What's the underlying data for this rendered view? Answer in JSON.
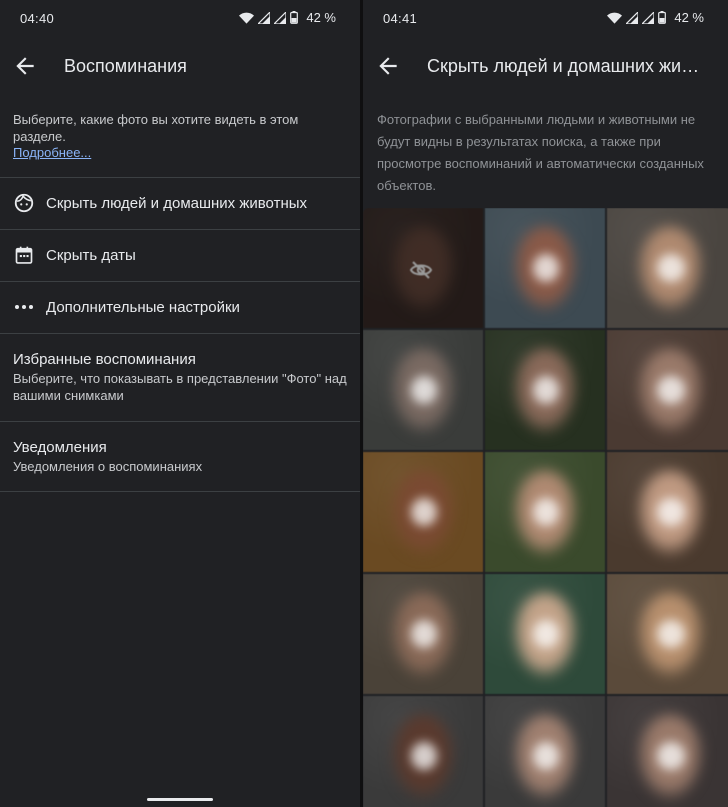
{
  "left": {
    "status": {
      "time": "04:40",
      "battery": "42 %"
    },
    "title": "Воспоминания",
    "intro": {
      "text": "Выберите, какие фото вы хотите видеть в этом разделе.",
      "link": "Подробнее..."
    },
    "menu": [
      {
        "label": "Скрыть людей и домашних животных",
        "icon": "face-icon"
      },
      {
        "label": "Скрыть даты",
        "icon": "calendar-icon"
      },
      {
        "label": "Дополнительные настройки",
        "icon": "more-icon"
      }
    ],
    "settings": [
      {
        "title": "Избранные воспоминания",
        "subtitle": "Выберите, что показывать в представлении \"Фото\" над вашими снимками"
      },
      {
        "title": "Уведомления",
        "subtitle": "Уведомления о воспоминаниях"
      }
    ]
  },
  "right": {
    "status": {
      "time": "04:41",
      "battery": "42 %"
    },
    "title": "Скрыть людей и домашних животных",
    "intro": "Фотографии с выбранными людьми и животными не будут видны в результатах поиска, а также при просмотре воспоминаний и автоматически созданных объектов.",
    "faces": [
      {
        "skin": "#6a4a3e",
        "bg": "#3a2c28",
        "hidden": true
      },
      {
        "skin": "#8a5a48",
        "bg": "#3d4a52"
      },
      {
        "skin": "#b08a70",
        "bg": "#4a4540"
      },
      {
        "skin": "#7a6a62",
        "bg": "#3a3c3a"
      },
      {
        "skin": "#8a6a5a",
        "bg": "#263020"
      },
      {
        "skin": "#9a7a6a",
        "bg": "#4a3a32"
      },
      {
        "skin": "#7a4a32",
        "bg": "#6a4a22"
      },
      {
        "skin": "#b08a72",
        "bg": "#3a4a2c"
      },
      {
        "skin": "#c09a82",
        "bg": "#4a3a2e"
      },
      {
        "skin": "#8a6a58",
        "bg": "#4a4238"
      },
      {
        "skin": "#c4a48a",
        "bg": "#2e4a3a"
      },
      {
        "skin": "#b8906e",
        "bg": "#5a4a3a"
      },
      {
        "skin": "#5a3a2e",
        "bg": "#3a3a3a"
      },
      {
        "skin": "#a08070",
        "bg": "#3a3a3a"
      },
      {
        "skin": "#9a7a6a",
        "bg": "#3a3434"
      }
    ]
  }
}
